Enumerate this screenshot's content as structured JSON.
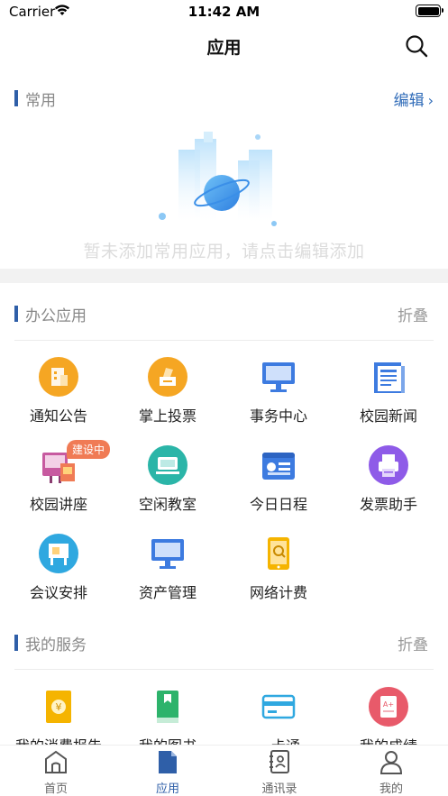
{
  "status_bar": {
    "carrier": "Carrier",
    "time": "11:42 AM"
  },
  "nav": {
    "title": "应用",
    "search_icon": "search-icon"
  },
  "common": {
    "title": "常用",
    "edit_label": "编辑",
    "empty_text": "暂未添加常用应用，请点击编辑添加"
  },
  "office": {
    "title": "办公应用",
    "collapse_label": "折叠",
    "items": [
      {
        "label": "通知公告",
        "icon": "notice-icon",
        "color": "#f5a623"
      },
      {
        "label": "掌上投票",
        "icon": "vote-icon",
        "color": "#f5a623"
      },
      {
        "label": "事务中心",
        "icon": "monitor-icon",
        "color": "#3d7be0"
      },
      {
        "label": "校园新闻",
        "icon": "news-icon",
        "color": "#3d7be0"
      },
      {
        "label": "校园讲座",
        "icon": "lecture-icon",
        "color": "#c75aa0",
        "badge": "建设中"
      },
      {
        "label": "空闲教室",
        "icon": "classroom-icon",
        "color": "#2bb5a8"
      },
      {
        "label": "今日日程",
        "icon": "schedule-icon",
        "color": "#3d7be0"
      },
      {
        "label": "发票助手",
        "icon": "printer-icon",
        "color": "#8e5be8"
      },
      {
        "label": "会议安排",
        "icon": "meeting-icon",
        "color": "#2fa8e0"
      },
      {
        "label": "资产管理",
        "icon": "asset-monitor-icon",
        "color": "#3d7be0"
      },
      {
        "label": "网络计费",
        "icon": "phone-billing-icon",
        "color": "#f5b400"
      }
    ]
  },
  "services": {
    "title": "我的服务",
    "collapse_label": "折叠",
    "items": [
      {
        "label": "我的消费报告",
        "icon": "consumption-report-icon",
        "color": "#f5b400"
      },
      {
        "label": "我的图书",
        "icon": "book-icon",
        "color": "#2db36b"
      },
      {
        "label": "一卡通",
        "icon": "card-icon",
        "color": "#2fa8e0"
      },
      {
        "label": "我的成绩",
        "icon": "grade-icon",
        "color": "#e85a6a"
      }
    ]
  },
  "tabs": [
    {
      "label": "首页",
      "icon": "home-icon"
    },
    {
      "label": "应用",
      "icon": "apps-icon",
      "active": true
    },
    {
      "label": "通讯录",
      "icon": "contacts-icon"
    },
    {
      "label": "我的",
      "icon": "profile-icon"
    }
  ]
}
